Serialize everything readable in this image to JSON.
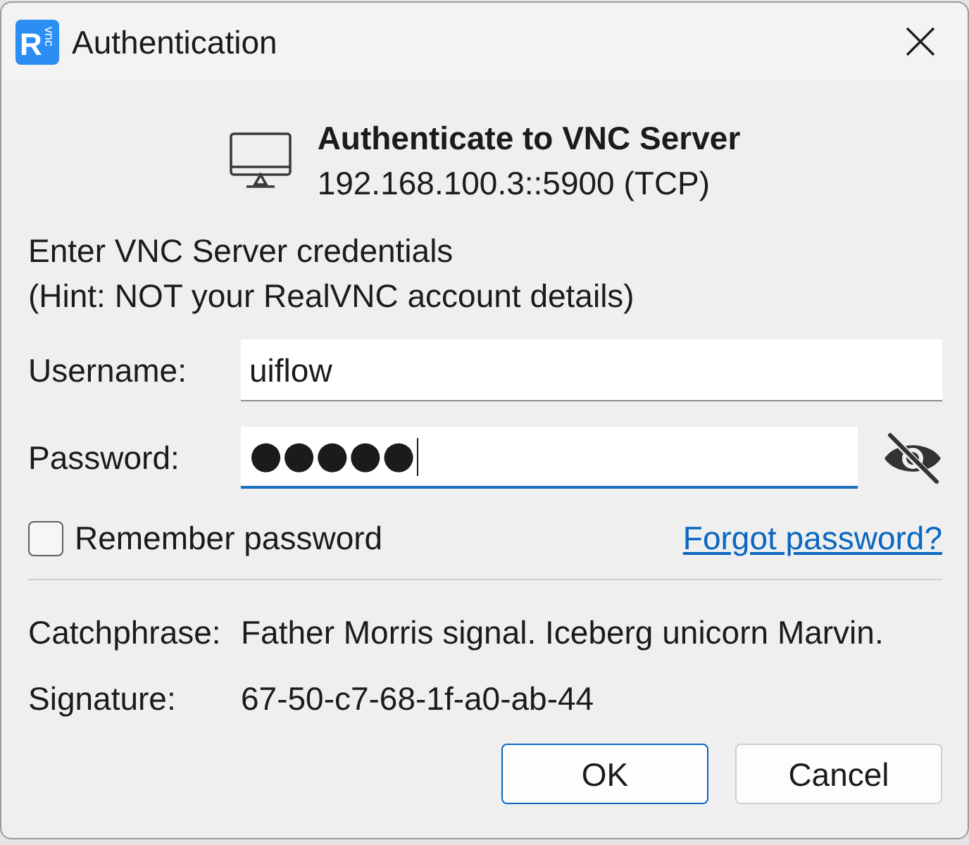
{
  "window": {
    "title": "Authentication",
    "logo": {
      "letter": "R",
      "tag": "vnc"
    }
  },
  "header": {
    "title": "Authenticate to VNC Server",
    "address": "192.168.100.3::5900 (TCP)"
  },
  "instructions": [
    "Enter VNC Server credentials",
    "(Hint: NOT your RealVNC account details)"
  ],
  "fields": [
    {
      "kind": "text",
      "label": "Username:",
      "value": "uiflow",
      "focused": false
    },
    {
      "kind": "password",
      "label": "Password:",
      "value": "●●●●●",
      "focused": true
    }
  ],
  "remember_password": {
    "label": "Remember password",
    "checked": false
  },
  "forgot_link": "Forgot password?",
  "details": [
    {
      "label": "Catchphrase:",
      "value": "Father Morris signal. Iceberg unicorn Marvin."
    },
    {
      "label": "Signature:",
      "value": "67-50-c7-68-1f-a0-ab-44"
    }
  ],
  "buttons": [
    {
      "label": "OK",
      "default": true
    },
    {
      "label": "Cancel",
      "default": false
    }
  ]
}
